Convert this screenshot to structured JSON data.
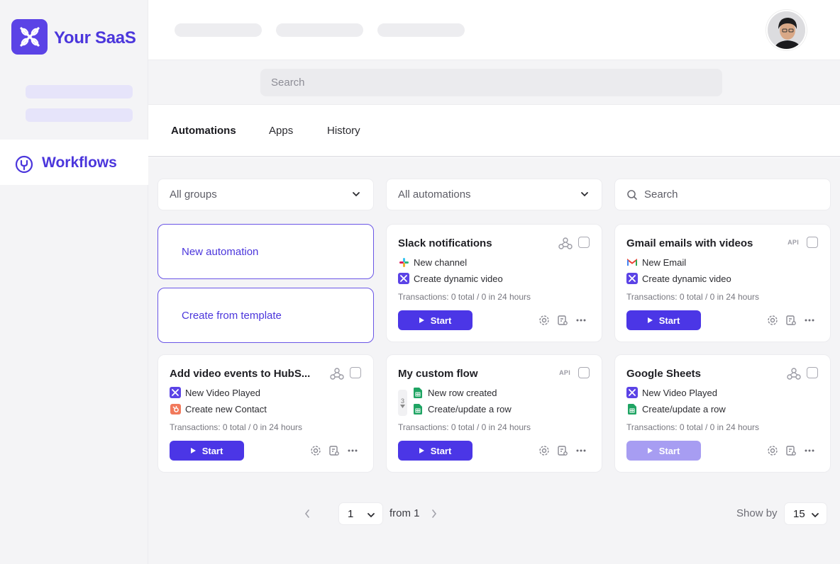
{
  "brand": {
    "name": "Your SaaS"
  },
  "sidebar": {
    "active_item": "Workflows"
  },
  "header": {
    "search_placeholder": "Search"
  },
  "tabs": [
    {
      "label": "Automations",
      "active": true
    },
    {
      "label": "Apps",
      "active": false
    },
    {
      "label": "History",
      "active": false
    }
  ],
  "filters": {
    "groups": "All groups",
    "automations": "All automations",
    "search_placeholder": "Search"
  },
  "actions": {
    "new_automation": "New automation",
    "create_from_template": "Create from template"
  },
  "cards": [
    {
      "title": "Slack notifications",
      "badge": "webhook-icon",
      "trigger": {
        "icon": "slack-icon",
        "label": "New channel"
      },
      "action": {
        "icon": "saas-icon",
        "label": "Create dynamic video"
      },
      "transactions": "Transactions: 0 total / 0 in 24 hours",
      "start": "Start",
      "enabled": true
    },
    {
      "title": "Gmail emails with videos",
      "badge": "API",
      "trigger": {
        "icon": "gmail-icon",
        "label": "New Email"
      },
      "action": {
        "icon": "saas-icon",
        "label": "Create dynamic video"
      },
      "transactions": "Transactions: 0 total / 0 in 24 hours",
      "start": "Start",
      "enabled": true
    },
    {
      "title": "Add video events to HubS...",
      "badge": "webhook-icon",
      "trigger": {
        "icon": "saas-icon",
        "label": "New Video Played"
      },
      "action": {
        "icon": "hubspot-icon",
        "label": "Create new Contact"
      },
      "transactions": "Transactions: 0 total / 0 in 24 hours",
      "start": "Start",
      "enabled": true
    },
    {
      "title": "My custom flow",
      "badge": "API",
      "step_count": "3",
      "trigger": {
        "icon": "sheets-icon",
        "label": "New row created"
      },
      "action": {
        "icon": "sheets-icon",
        "label": "Create/update a row"
      },
      "transactions": "Transactions: 0 total / 0 in 24 hours",
      "start": "Start",
      "enabled": true
    },
    {
      "title": "Google Sheets",
      "badge": "webhook-icon",
      "trigger": {
        "icon": "saas-icon",
        "label": "New Video Played"
      },
      "action": {
        "icon": "sheets-icon",
        "label": "Create/update a row"
      },
      "transactions": "Transactions: 0 total / 0 in 24 hours",
      "start": "Start",
      "enabled": false
    }
  ],
  "pagination": {
    "page": "1",
    "from": "from 1",
    "show_by_label": "Show by",
    "show_by_value": "15"
  },
  "colors": {
    "accent": "#4b36e6",
    "accent_light": "#a79df2",
    "background": "#f4f4f6"
  }
}
